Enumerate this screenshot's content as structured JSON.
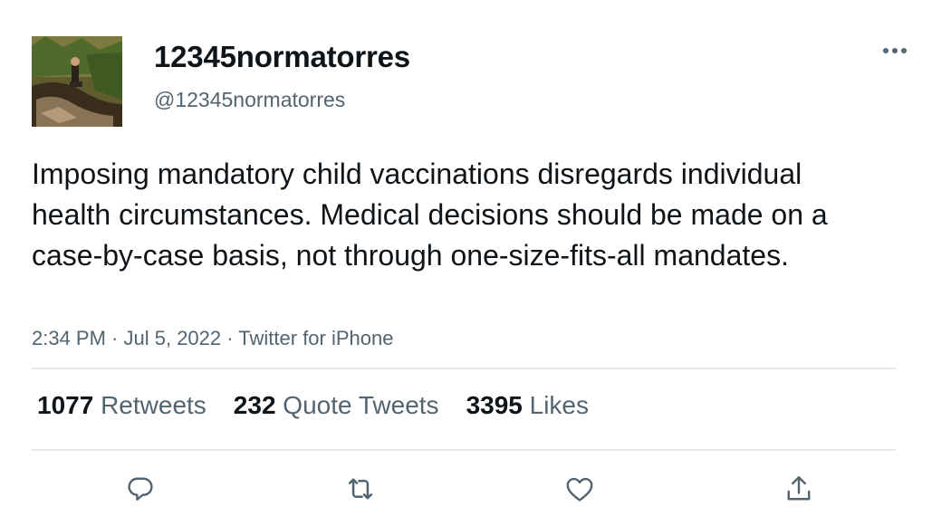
{
  "user": {
    "display_name": "12345normatorres",
    "handle": "@12345normatorres"
  },
  "tweet": {
    "text": "Imposing mandatory child vaccinations disregards individual health circumstances. Medical decisions should be made on a case-by-case basis, not through one-size-fits-all mandates.",
    "time": "2:34 PM",
    "date": "Jul 5, 2022",
    "source": "Twitter for iPhone"
  },
  "stats": {
    "retweets_count": "1077",
    "retweets_label": "Retweets",
    "quotes_count": "232",
    "quotes_label": "Quote Tweets",
    "likes_count": "3395",
    "likes_label": "Likes"
  },
  "icons": {
    "more": "more-horizontal-icon",
    "reply": "reply-icon",
    "retweet": "retweet-icon",
    "like": "heart-icon",
    "share": "share-icon"
  },
  "colors": {
    "text": "#0f1419",
    "secondary": "#536471",
    "divider": "#e6e9eb"
  }
}
